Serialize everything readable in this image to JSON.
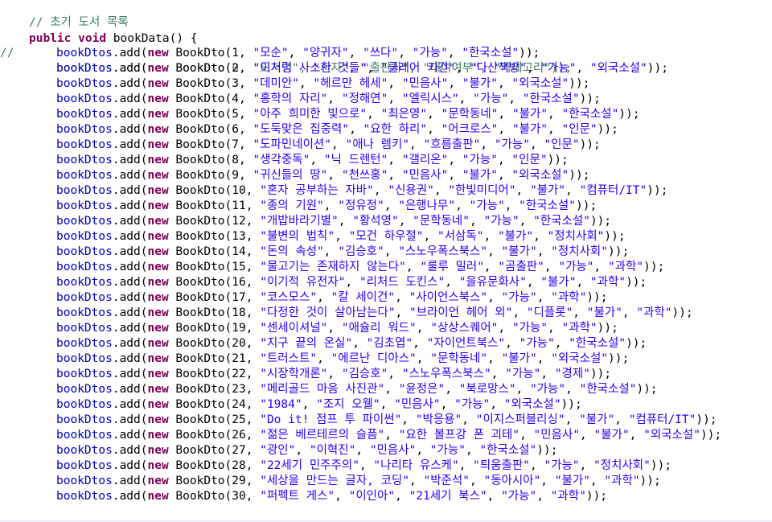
{
  "colors": {
    "keyword": "#7f0055",
    "comment": "#3f7f5f",
    "field": "#0000c0",
    "string": "#2a00ff",
    "default": "#000000"
  },
  "header": {
    "comment": "// 초기 도서 목록",
    "kw_public": "public",
    "kw_void": "void",
    "method_sig": "bookData() {"
  },
  "commented_line": {
    "gutter": "//",
    "text": "bookDtos.add(new BookDto(0, \"도서명\", \"저자\", \"출판사\", \"대여여부\", \"카테고리\"));"
  },
  "tokens": {
    "list_name": "bookDtos",
    "add_call": ".add(",
    "kw_new": "new",
    "ctor": " BookDto(",
    "closing": "));"
  },
  "books": [
    {
      "id": "1",
      "title": "모순",
      "author": "양귀자",
      "publisher": "쓰다",
      "status": "가능",
      "category": "한국소설"
    },
    {
      "id": "2",
      "title": "이처럼 사소한 것들",
      "author": "클레어 키건",
      "publisher": "다산책방",
      "status": "가능",
      "category": "외국소설"
    },
    {
      "id": "3",
      "title": "데미안",
      "author": "헤르만 헤세",
      "publisher": "민음사",
      "status": "불가",
      "category": "외국소설"
    },
    {
      "id": "4",
      "title": "홍학의 자리",
      "author": "정해연",
      "publisher": "엘릭시스",
      "status": "가능",
      "category": "한국소설"
    },
    {
      "id": "5",
      "title": "아주 희미한 빛으로",
      "author": "최은영",
      "publisher": "문학동네",
      "status": "불가",
      "category": "한국소설"
    },
    {
      "id": "6",
      "title": "도둑맞은 집중력",
      "author": "요한 하리",
      "publisher": "어크로스",
      "status": "불가",
      "category": "인문"
    },
    {
      "id": "7",
      "title": "도파민네이션",
      "author": "애나 렘키",
      "publisher": "흐름출판",
      "status": "가능",
      "category": "인문"
    },
    {
      "id": "8",
      "title": "생각중독",
      "author": "닉 드렌턴",
      "publisher": "갤리온",
      "status": "가능",
      "category": "인문"
    },
    {
      "id": "9",
      "title": "귀신들의 땅",
      "author": "천쓰홍",
      "publisher": "민음사",
      "status": "불가",
      "category": "외국소설"
    },
    {
      "id": "10",
      "title": "혼자 공부하는 자바",
      "author": "신용권",
      "publisher": "한빛미디어",
      "status": "불가",
      "category": "컴퓨터/IT"
    },
    {
      "id": "11",
      "title": "종의 기원",
      "author": "정유정",
      "publisher": "은행나무",
      "status": "가능",
      "category": "한국소설"
    },
    {
      "id": "12",
      "title": "개밥바라기별",
      "author": "황석영",
      "publisher": "문학동네",
      "status": "가능",
      "category": "한국소설"
    },
    {
      "id": "13",
      "title": "불변의 법칙",
      "author": "모건 하우절",
      "publisher": "서삼독",
      "status": "불가",
      "category": "정치사회"
    },
    {
      "id": "14",
      "title": "돈의 속성",
      "author": "김승호",
      "publisher": "스노우폭스북스",
      "status": "불가",
      "category": "정치사회"
    },
    {
      "id": "15",
      "title": "물고기는 존재하지 않는다",
      "author": "룰루 밀러",
      "publisher": "곰출판",
      "status": "가능",
      "category": "과학"
    },
    {
      "id": "16",
      "title": "이기적 유전자",
      "author": "리처드 도킨스",
      "publisher": "을유문화사",
      "status": "불가",
      "category": "과학"
    },
    {
      "id": "17",
      "title": "코스모스",
      "author": "칼 세이건",
      "publisher": "사이언스북스",
      "status": "가능",
      "category": "과학"
    },
    {
      "id": "18",
      "title": "다정한 것이 살아남는다",
      "author": "브라이언 헤어 외",
      "publisher": "디플롯",
      "status": "불가",
      "category": "과학"
    },
    {
      "id": "19",
      "title": "센세이셔널",
      "author": "애슐리 워드",
      "publisher": "상상스퀘어",
      "status": "가능",
      "category": "과학"
    },
    {
      "id": "20",
      "title": "지구 끝의 온실",
      "author": "김초엽",
      "publisher": "자이언트북스",
      "status": "가능",
      "category": "한국소설"
    },
    {
      "id": "21",
      "title": "트러스트",
      "author": "에르난 디아스",
      "publisher": "문학동네",
      "status": "불가",
      "category": "외국소설"
    },
    {
      "id": "22",
      "title": "시장학개론",
      "author": "김승호",
      "publisher": "스노우폭스북스",
      "status": "가능",
      "category": "경제"
    },
    {
      "id": "23",
      "title": "메리골드 마음 사진관",
      "author": "윤정은",
      "publisher": "북로망스",
      "status": "가능",
      "category": "한국소설"
    },
    {
      "id": "24",
      "title": "1984",
      "author": "조지 오웰",
      "publisher": "민음사",
      "status": "가능",
      "category": "외국소설"
    },
    {
      "id": "25",
      "title": "Do it! 점프 투 파이썬",
      "author": "박응용",
      "publisher": "이지스퍼블리싱",
      "status": "불가",
      "category": "컴퓨터/IT"
    },
    {
      "id": "26",
      "title": "젊은 베르테르의 슬픔",
      "author": "요한 볼프강 폰 괴테",
      "publisher": "민음사",
      "status": "불가",
      "category": "외국소설"
    },
    {
      "id": "27",
      "title": "광인",
      "author": "이혁진",
      "publisher": "민음사",
      "status": "가능",
      "category": "한국소설"
    },
    {
      "id": "28",
      "title": "22세기 민주주의",
      "author": "나리타 유스케",
      "publisher": "틔움출판",
      "status": "가능",
      "category": "정치사회"
    },
    {
      "id": "29",
      "title": "세상을 만드는 글자, 코딩",
      "author": "박준석",
      "publisher": "동아시아",
      "status": "불가",
      "category": "과학"
    },
    {
      "id": "30",
      "title": "퍼펙트 게스",
      "author": "이인아",
      "publisher": "21세기 북스",
      "status": "가능",
      "category": "과학"
    }
  ],
  "footer": {
    "closing_brace": "}"
  }
}
